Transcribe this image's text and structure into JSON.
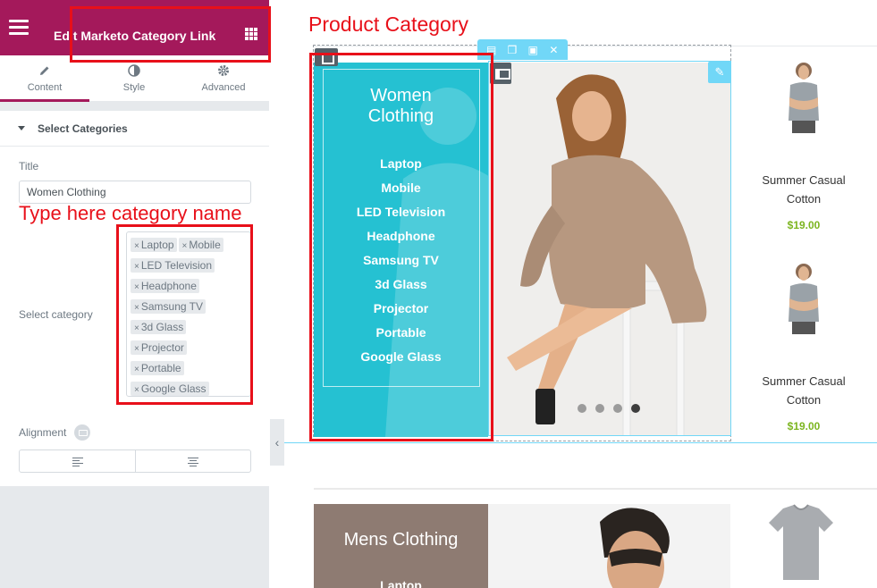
{
  "panel": {
    "title": "Edit Marketo Category Link",
    "tabs": [
      {
        "label": "Content",
        "icon": "pencil-icon",
        "active": true
      },
      {
        "label": "Style",
        "icon": "half-circle-icon",
        "active": false
      },
      {
        "label": "Advanced",
        "icon": "gear-icon",
        "active": false
      }
    ],
    "section_title": "Select Categories",
    "title_label": "Title",
    "title_value": "Women Clothing",
    "select_label": "Select category",
    "selected_categories": [
      "Laptop",
      "Mobile",
      "LED Television",
      "Headphone",
      "Samsung TV",
      "3d Glass",
      "Projector",
      "Portable",
      "Google Glass"
    ],
    "alignment_label": "Alignment",
    "accent_color": "#a4195b"
  },
  "annotations": {
    "product_category": "Product Category",
    "type_here": "Type here category name",
    "color": "#e8101a"
  },
  "preview": {
    "category_card": {
      "title": "Women Clothing",
      "links": [
        "Laptop",
        "Mobile",
        "LED Television",
        "Headphone",
        "Samsung TV",
        "3d Glass",
        "Projector",
        "Portable",
        "Google Glass"
      ],
      "color": "#25c1d2"
    },
    "slider": {
      "dots": 4,
      "active_dot": 4
    },
    "products": [
      {
        "name": "Summer Casual Cotton",
        "price": "$19.00"
      },
      {
        "name": "Summer Casual Cotton",
        "price": "$19.00"
      }
    ],
    "second_card": {
      "title": "Mens Clothing",
      "first_link": "Laptop"
    },
    "price_color": "#7cb520",
    "editor_accent": "#71d7f7"
  }
}
